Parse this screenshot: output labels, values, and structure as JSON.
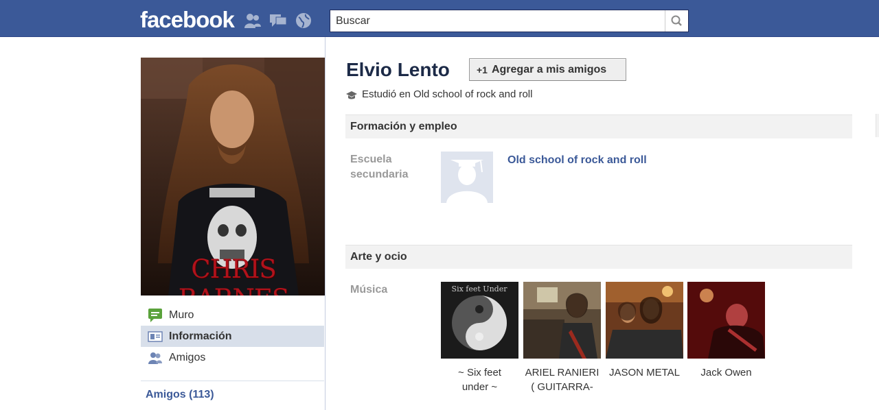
{
  "topbar": {
    "logo": "facebook",
    "jewels": [
      "friend-requests-icon",
      "messages-icon",
      "notifications-icon"
    ],
    "search": {
      "placeholder": "Buscar",
      "value": ""
    }
  },
  "sidebar": {
    "profile_picture_text": "CHRIS BARNES",
    "items": [
      {
        "label": "Muro",
        "icon": "wall-icon",
        "active": false
      },
      {
        "label": "Información",
        "icon": "info-icon",
        "active": true
      },
      {
        "label": "Amigos",
        "icon": "friends-icon",
        "active": false
      }
    ],
    "friends_label": "Amigos (113)"
  },
  "profile": {
    "name": "Elvio Lento",
    "add_friend_label": "Agregar a mis amigos",
    "add_friend_prefix": "+1",
    "studied": "Estudió en Old school of rock and roll"
  },
  "sections": {
    "education": {
      "title": "Formación y empleo",
      "label_line1": "Escuela",
      "label_line2": "secundaria",
      "school": "Old school of rock and roll"
    },
    "arts": {
      "title": "Arte y ocio",
      "label": "Música",
      "music": [
        {
          "caption_line1": "~ Six feet",
          "caption_line2": "under ~",
          "thumb_text": "Six feet Under"
        },
        {
          "caption_line1": "ARIEL RANIERI",
          "caption_line2": "( GUITARRA-"
        },
        {
          "caption_line1": "JASON METAL",
          "caption_line2": ""
        },
        {
          "caption_line1": "Jack Owen",
          "caption_line2": ""
        }
      ]
    }
  },
  "colors": {
    "brand": "#3b5998",
    "link": "#3b5998",
    "section_bg": "#f2f2f2",
    "active_nav": "#d8dfea"
  }
}
